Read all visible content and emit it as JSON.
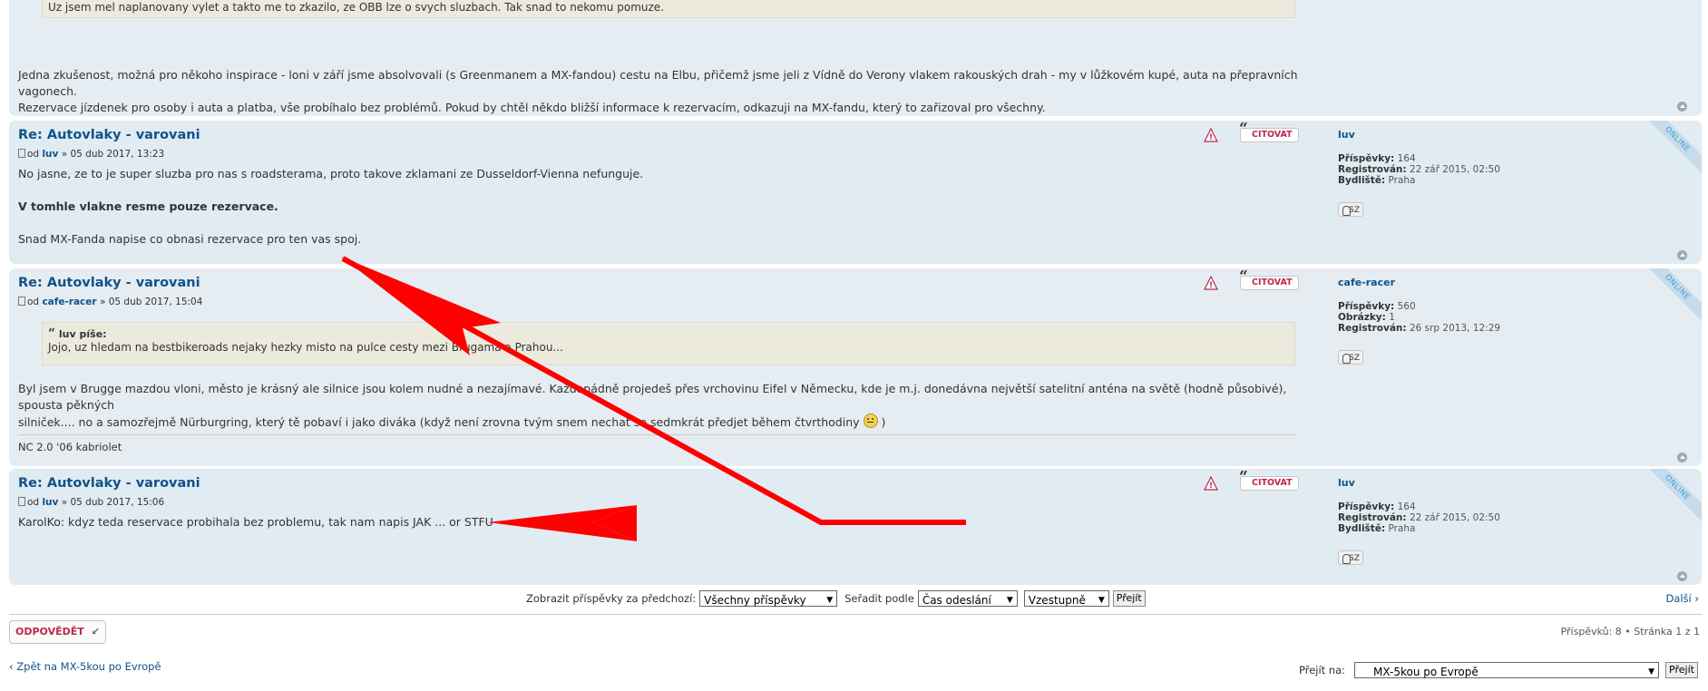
{
  "quote_top": "Uz jsem mel naplanovany vylet a takto me to zkazilo, ze OBB lze o svych sluzbach. Tak snad to nekomu pomuze.",
  "post0": {
    "line1": "Jedna zkušenost, možná pro někoho inspirace - loni v září jsme absolvovali (s Greenmanem a MX-fandou) cestu na Elbu, přičemž jsme jeli z Vídně do Verony vlakem rakouských drah - my v lůžkovém kupé, auta na přepravních vagonech.",
    "line2": "Rezervace jízdenek pro osoby i auta a platba, vše probíhalo bez problémů. Pokud by chtěl někdo bližší informace k rezervacím, odkazuji na MX-fandu, který to zařizoval pro všechny."
  },
  "labels": {
    "from": "od",
    "sep": "»",
    "quote_btn": "CITOVAT",
    "online": "ONLINE",
    "pm": "SZ",
    "posts": "Příspěvky:",
    "registered": "Registrován:",
    "residence": "Bydliště:",
    "images": "Obrázky:"
  },
  "posts": [
    {
      "title": "Re: Autovlaky - varovani",
      "author": "luv",
      "date": "05 dub 2017, 13:23",
      "lines": [
        "No jasne, ze to je super sluzba pro nas s roadsterama, proto takove zklamani ze Dusseldorf-Vienna nefunguje.",
        "V tomhle vlakne resme pouze rezervace.",
        "Snad MX-Fanda napise co obnasi rezervace pro ten vas spoj."
      ],
      "profile": {
        "name": "luv",
        "posts": "164",
        "registered": "22 zář 2015, 02:50",
        "residence": "Praha"
      }
    },
    {
      "title": "Re: Autovlaky - varovani",
      "author": "cafe-racer",
      "date": "05 dub 2017, 15:04",
      "quote_cite": "luv píše:",
      "quote_text": "Jojo, uz hledam na bestbikeroads nejaky hezky misto na pulce cesty mezi Brugama a Prahou...",
      "line1": "Byl jsem v Brugge mazdou vloni, město je krásný ale silnice jsou kolem nudné a nezajímavé. Každopádně projedeš přes vrchovinu Eifel v Německu, kde je m.j. donedávna největší satelitní anténa na světě (hodně působivé), spousta pěkných",
      "line2": "silniček.... no a samozřejmě Nürburgring, který tě pobaví i jako diváka (když není zrovna tvým snem nechat se sedmkrát předjet během čtvrthodiny",
      "line2_end": ")",
      "signature": "NC 2.0 '06 kabriolet",
      "profile": {
        "name": "cafe-racer",
        "posts": "560",
        "images": "1",
        "registered": "26 srp 2013, 12:29"
      }
    },
    {
      "title": "Re: Autovlaky - varovani",
      "author": "luv",
      "date": "05 dub 2017, 15:06",
      "lines": [
        "KarolKo: kdyz teda reservace probihala bez problemu, tak nam napis JAK ... or STFU"
      ],
      "profile": {
        "name": "luv",
        "posts": "164",
        "registered": "22 zář 2015, 02:50",
        "residence": "Praha"
      }
    }
  ],
  "sort_bar": {
    "show_label": "Zobrazit příspěvky za předchozí:",
    "show_value": "Všechny příspěvky",
    "sort_label": "Seřadit podle",
    "sort_value": "Čas odeslání",
    "dir_value": "Vzestupně",
    "go": "Přejít",
    "next": "Další"
  },
  "reply_button": "ODPOVĚDĚT",
  "pagination": "Příspěvků: 8 • Stránka 1 z 1",
  "back_link": "Zpět na MX-5kou po Evropě",
  "jump": {
    "label": "Přejít na:",
    "value": "MX-5kou po Evropě",
    "go": "Přejít"
  },
  "colors": {
    "link": "#105289",
    "accent_red": "#bc2a4d",
    "annotation_arrow": "#ff0000"
  }
}
